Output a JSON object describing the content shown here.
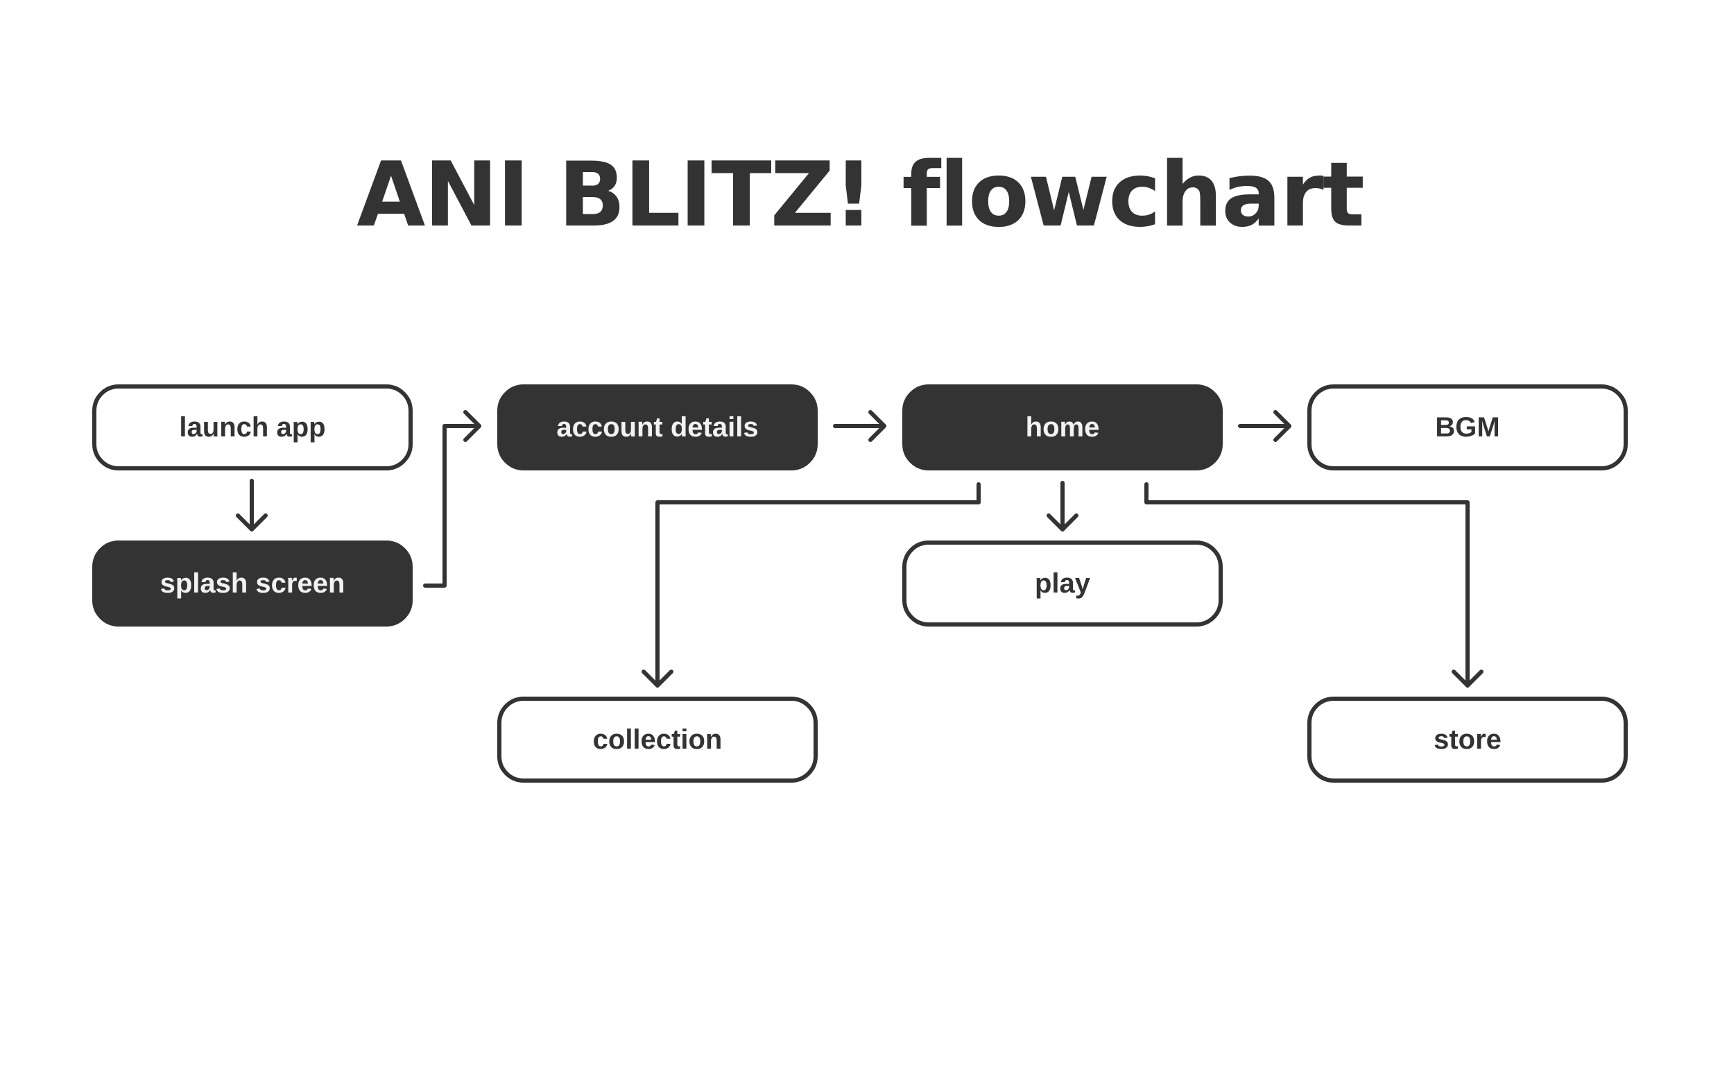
{
  "title": "ANI BLITZ! flowchart",
  "colors": {
    "ink": "#333333",
    "dark_node_text": "#f2f2f2",
    "background": "#ffffff"
  },
  "nodes": {
    "launch_app": {
      "label": "launch app",
      "style": "outline"
    },
    "splash_screen": {
      "label": "splash screen",
      "style": "filled"
    },
    "account_details": {
      "label": "account details",
      "style": "filled"
    },
    "home": {
      "label": "home",
      "style": "filled"
    },
    "bgm": {
      "label": "BGM",
      "style": "outline"
    },
    "play": {
      "label": "play",
      "style": "outline"
    },
    "collection": {
      "label": "collection",
      "style": "outline"
    },
    "store": {
      "label": "store",
      "style": "outline"
    }
  },
  "edges": [
    {
      "from": "launch app",
      "to": "splash screen"
    },
    {
      "from": "splash screen",
      "to": "account details"
    },
    {
      "from": "account details",
      "to": "home"
    },
    {
      "from": "home",
      "to": "BGM"
    },
    {
      "from": "home",
      "to": "play"
    },
    {
      "from": "home",
      "to": "collection"
    },
    {
      "from": "home",
      "to": "store"
    }
  ]
}
